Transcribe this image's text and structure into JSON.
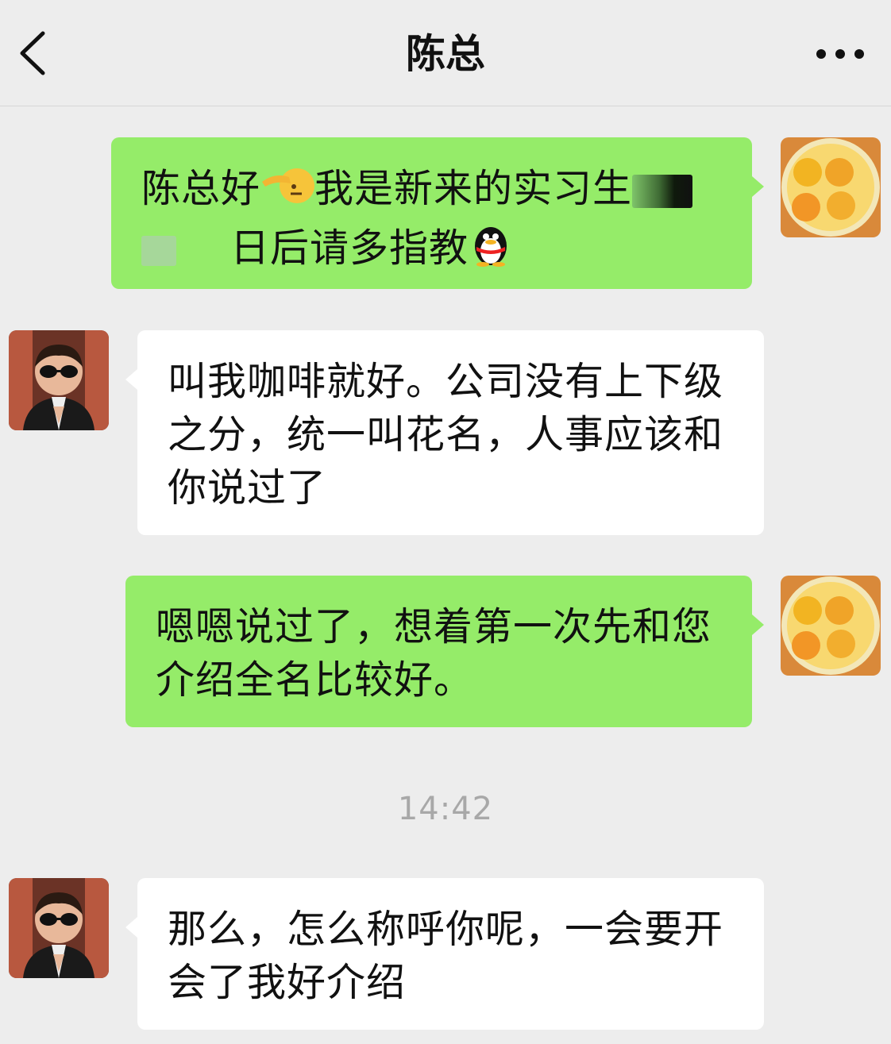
{
  "header": {
    "title": "陈总",
    "back_icon": "chevron-left-icon",
    "more_icon": "more-dots-icon"
  },
  "messages": [
    {
      "sender": "me",
      "line1_a": "陈总好",
      "line1_emoji": "saluting-face-emoji",
      "line1_b": "我是新来的实习生",
      "line2": "日后请多指教",
      "line2_emoji": "qq-penguin-emoji"
    },
    {
      "sender": "chen",
      "text": "叫我咖啡就好。公司没有上下级之分，统一叫花名，人事应该和你说过了"
    },
    {
      "sender": "me",
      "text": "嗯嗯说过了，想着第一次先和您介绍全名比较好。"
    },
    {
      "sender": "chen",
      "text": "那么，怎么称呼你呢，一会要开会了我好介绍"
    }
  ],
  "timestamp": "14:42",
  "colors": {
    "background": "#ededed",
    "my_bubble": "#95ec69",
    "their_bubble": "#ffffff",
    "timestamp": "#a8a8a8"
  }
}
